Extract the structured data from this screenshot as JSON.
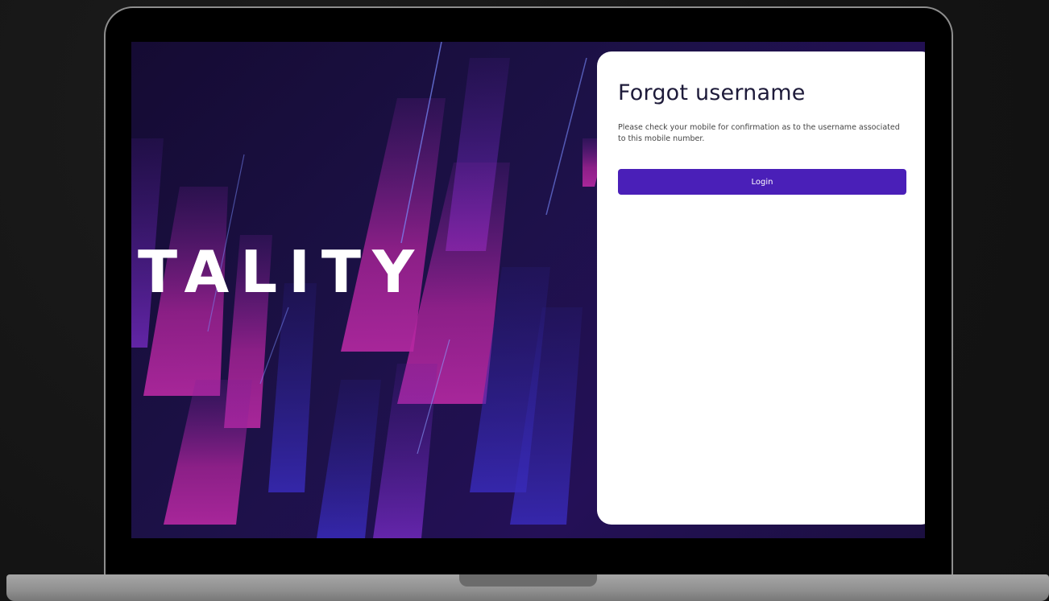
{
  "brand": {
    "text": "TALITY"
  },
  "forgot_username": {
    "title": "Forgot username",
    "message": "Please check your mobile for confirmation as to the username associated to this mobile number.",
    "login_label": "Login"
  },
  "colors": {
    "accent": "#4a1fb8",
    "background_dark": "#1a0f3a",
    "stripe_magenta": "#b0249c",
    "stripe_blue": "#3a2cc0",
    "card": "#ffffff",
    "title": "#1e1b3a"
  }
}
